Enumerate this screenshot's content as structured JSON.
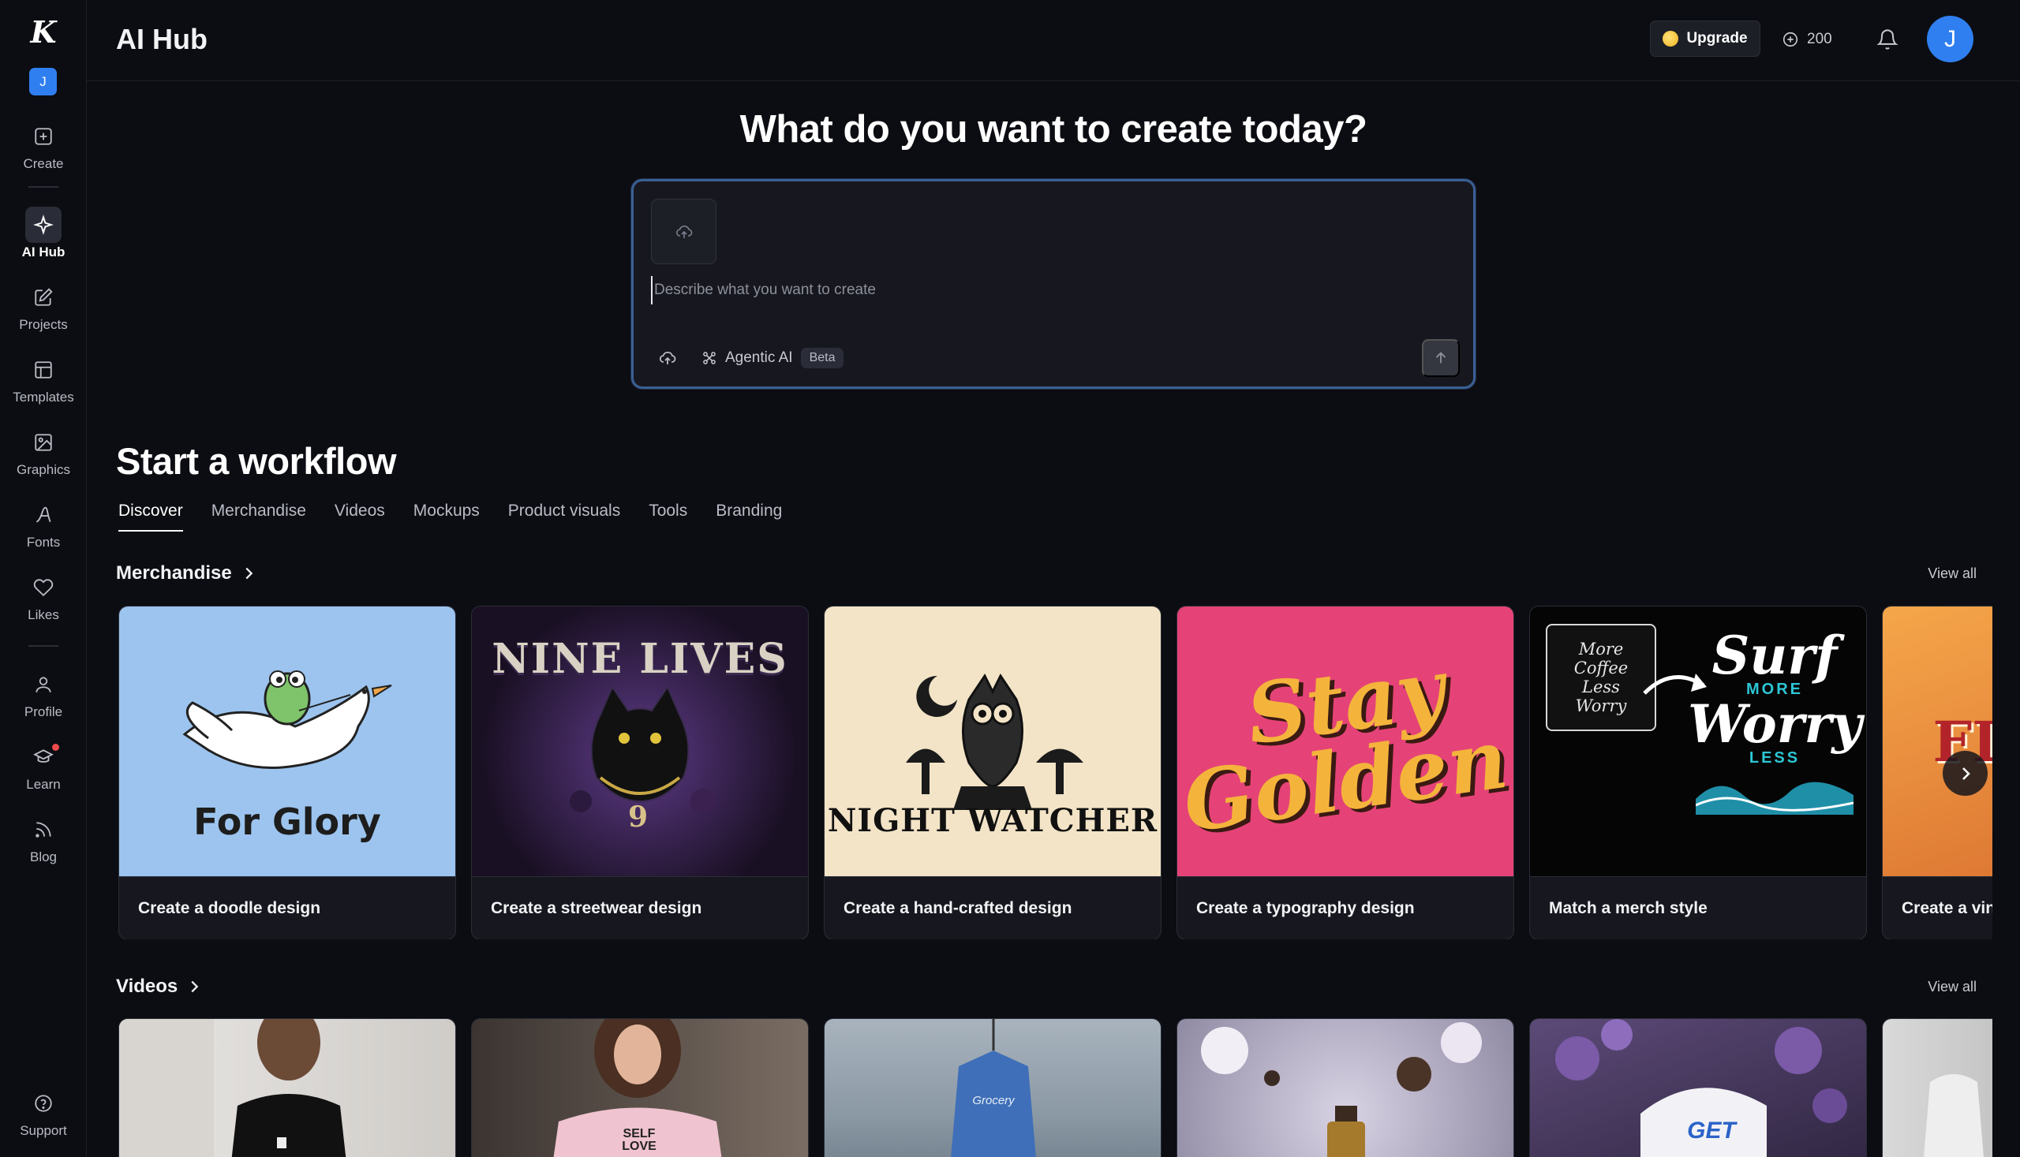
{
  "header": {
    "title": "AI Hub",
    "upgrade_label": "Upgrade",
    "credits": "200",
    "avatar_initial": "J"
  },
  "sidebar": {
    "workspace_initial": "J",
    "items": [
      {
        "label": "Create",
        "icon": "plus-square-icon"
      },
      {
        "label": "AI Hub",
        "icon": "sparkle-icon"
      },
      {
        "label": "Projects",
        "icon": "edit-icon"
      },
      {
        "label": "Templates",
        "icon": "template-icon"
      },
      {
        "label": "Graphics",
        "icon": "image-icon"
      },
      {
        "label": "Fonts",
        "icon": "font-icon"
      },
      {
        "label": "Likes",
        "icon": "heart-icon"
      },
      {
        "label": "Profile",
        "icon": "user-icon"
      },
      {
        "label": "Learn",
        "icon": "graduation-cap-icon"
      },
      {
        "label": "Blog",
        "icon": "rss-icon"
      },
      {
        "label": "Support",
        "icon": "help-circle-icon"
      }
    ]
  },
  "hero": {
    "title": "What do you want to create today?",
    "placeholder": "Describe what you want to create",
    "agentic_label": "Agentic AI",
    "beta_label": "Beta"
  },
  "workflow": {
    "title": "Start a workflow",
    "tabs": [
      "Discover",
      "Merchandise",
      "Videos",
      "Mockups",
      "Product visuals",
      "Tools",
      "Branding"
    ],
    "active_tab": "Discover"
  },
  "merch": {
    "title": "Merchandise",
    "view_all": "View all",
    "cards": [
      {
        "label": "Create a doodle design",
        "art_text": "For Glory"
      },
      {
        "label": "Create a streetwear design",
        "art_text": "NINE LIVES",
        "art_sub": "9"
      },
      {
        "label": "Create a hand-crafted design",
        "art_text": "NIGHT WATCHER"
      },
      {
        "label": "Create a typography design",
        "art_text": "Stay",
        "art_text2": "Golden"
      },
      {
        "label": "Match a merch style",
        "art_small": "More Coffee Less Worry",
        "art_text": "Surf",
        "art_mid": "MORE",
        "art_text2": "Worry",
        "art_tail": "LESS"
      },
      {
        "label": "Create a vin",
        "art_text": "FL"
      }
    ]
  },
  "videos": {
    "title": "Videos",
    "view_all": "View all",
    "shirt_text_1": "SELF",
    "shirt_text_2": "LOVE",
    "hanger_text": "Grocery",
    "can_text": "GET"
  },
  "colors": {
    "accent": "#2f7ff0",
    "background": "#0c0d12",
    "card": "#17181f",
    "prompt_border": "#3a5f93"
  }
}
